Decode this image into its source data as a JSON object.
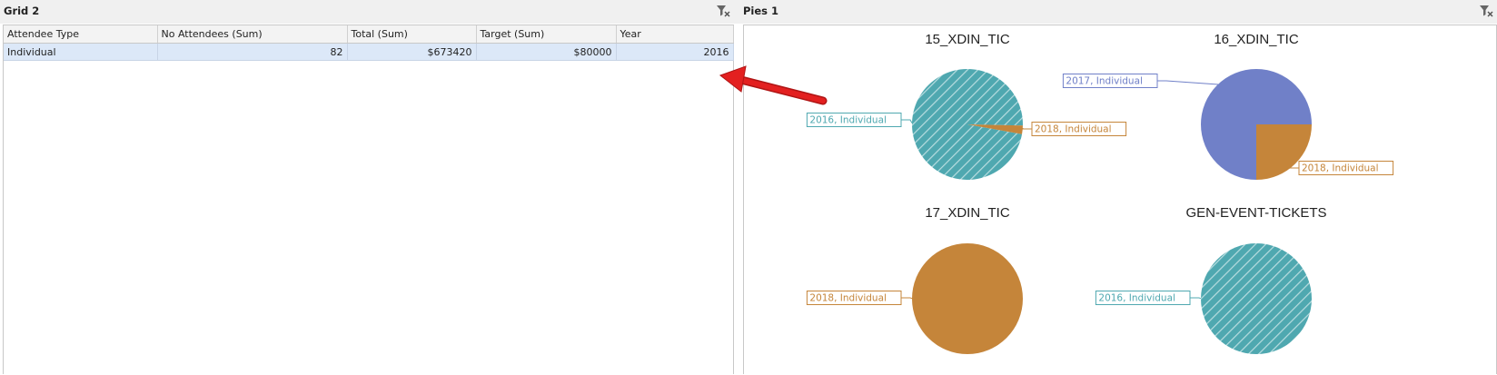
{
  "grid": {
    "title": "Grid 2",
    "columns": [
      "Attendee Type",
      "No Attendees (Sum)",
      "Total (Sum)",
      "Target (Sum)",
      "Year"
    ],
    "rows": [
      [
        "Individual",
        "82",
        "$673420",
        "$80000",
        "2016"
      ]
    ]
  },
  "pies": {
    "title": "Pies 1"
  },
  "icons": {
    "clear_filter": "filter-clear-icon",
    "arrow": "red-arrow-annotation"
  },
  "colors": {
    "series_2016": "#4fa8b0",
    "series_2017": "#7080c8",
    "series_2018": "#c5853a",
    "arrow": "#e32020"
  },
  "chart_data": [
    {
      "type": "pie",
      "title": "15_XDIN_TIC",
      "slices": [
        {
          "label": "2016, Individual",
          "value": 0.975,
          "color": "#4fa8b0",
          "pattern": "hatch"
        },
        {
          "label": "2018, Individual",
          "value": 0.025,
          "color": "#c5853a"
        }
      ]
    },
    {
      "type": "pie",
      "title": "16_XDIN_TIC",
      "slices": [
        {
          "label": "2017, Individual",
          "value": 0.75,
          "color": "#7080c8"
        },
        {
          "label": "2018, Individual",
          "value": 0.25,
          "color": "#c5853a"
        }
      ]
    },
    {
      "type": "pie",
      "title": "17_XDIN_TIC",
      "slices": [
        {
          "label": "2018, Individual",
          "value": 1.0,
          "color": "#c5853a"
        }
      ]
    },
    {
      "type": "pie",
      "title": "GEN-EVENT-TICKETS",
      "slices": [
        {
          "label": "2016, Individual",
          "value": 1.0,
          "color": "#4fa8b0",
          "pattern": "hatch"
        }
      ]
    }
  ]
}
